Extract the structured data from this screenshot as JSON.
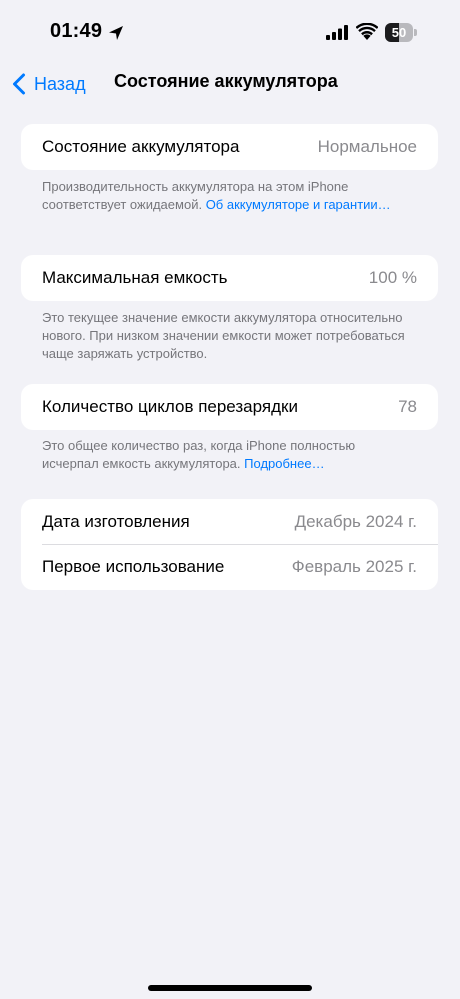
{
  "status_bar": {
    "time": "01:49",
    "battery_level": "50",
    "battery_fraction": 0.5
  },
  "nav": {
    "back_label": "Назад",
    "title": "Состояние аккумулятора"
  },
  "health": {
    "label": "Состояние аккумулятора",
    "value": "Нормальное",
    "footnote": "Производительность аккумулятора на этом iPhone соответствует ожидаемой.",
    "link": "Об аккумуляторе и гарантии…"
  },
  "capacity": {
    "label": "Максимальная емкость",
    "value": "100 %",
    "footnote": "Это текущее значение емкости аккумулятора относительно нового. При низком значении емкости может потребоваться чаще заряжать устройство."
  },
  "cycles": {
    "label": "Количество циклов перезарядки",
    "value": "78",
    "footnote": "Это общее количество раз, когда iPhone полностью исчерпал емкость аккумулятора.",
    "link": "Подробнее…"
  },
  "dates": {
    "manufacture_label": "Дата изготовления",
    "manufacture_value": "Декабрь 2024 г.",
    "first_use_label": "Первое использование",
    "first_use_value": "Февраль 2025 г."
  },
  "colors": {
    "accent": "#007aff",
    "background": "#f2f2f7",
    "secondary_text": "#8a8a8e"
  }
}
